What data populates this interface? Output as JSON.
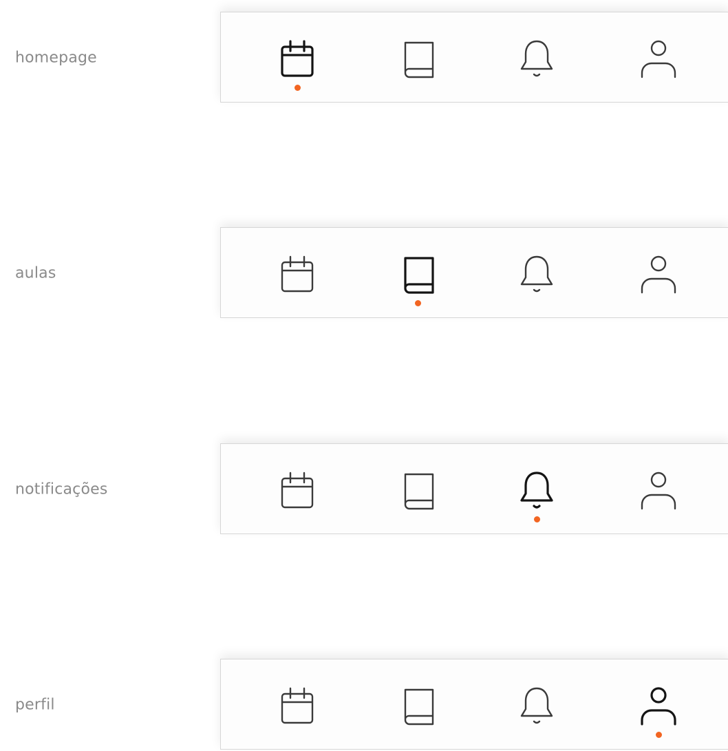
{
  "colors": {
    "label": "#8a8a8a",
    "active_stroke": "#141414",
    "inactive_stroke": "#3a3a3a",
    "indicator": "#f26522",
    "bar_background": "#fdfdfd",
    "bar_border": "#d6d6d6"
  },
  "tabs": [
    {
      "id": "calendar",
      "icon": "calendar-icon"
    },
    {
      "id": "book",
      "icon": "book-icon"
    },
    {
      "id": "bell",
      "icon": "bell-icon"
    },
    {
      "id": "user",
      "icon": "user-icon"
    }
  ],
  "rows": [
    {
      "label": "homepage",
      "active_tab": 0
    },
    {
      "label": "aulas",
      "active_tab": 1
    },
    {
      "label": "notificações",
      "active_tab": 2
    },
    {
      "label": "perfil",
      "active_tab": 3
    }
  ]
}
